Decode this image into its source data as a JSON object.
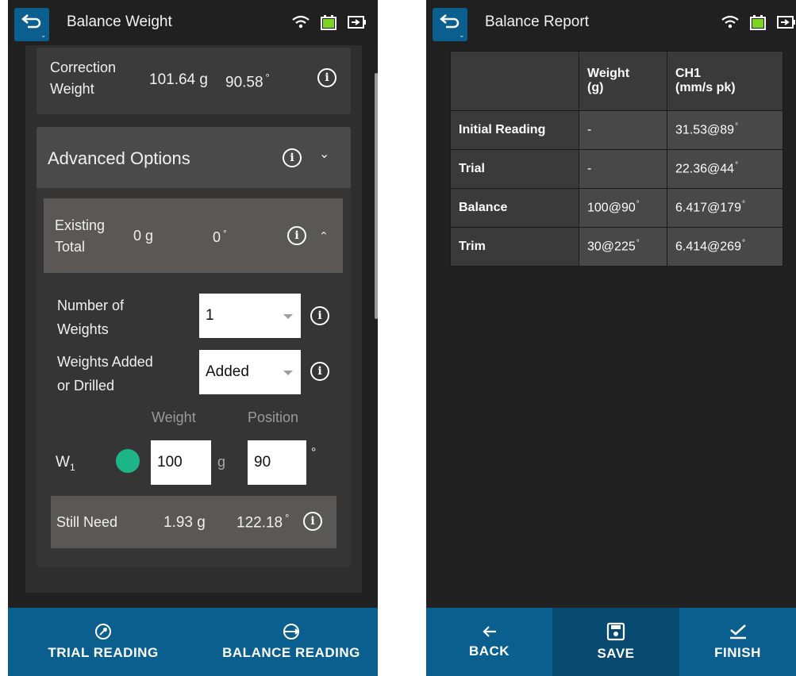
{
  "left": {
    "title": "Balance Weight",
    "correction": {
      "label_line1": "Correction",
      "label_line2": "Weight",
      "weight": "101.64 g",
      "angle": "90.58",
      "deg": "°"
    },
    "advanced": {
      "title": "Advanced Options"
    },
    "existing": {
      "label_line1": "Existing",
      "label_line2": "Total",
      "weight": "0 g",
      "angle": "0",
      "deg": "°"
    },
    "num_weights": {
      "label_line1": "Number of",
      "label_line2": "Weights",
      "value": "1"
    },
    "weights_added": {
      "label_line1": "Weights Added",
      "label_line2": "or Drilled",
      "value": "Added"
    },
    "columns": {
      "weight": "Weight",
      "position": "Position"
    },
    "w1": {
      "label": "W",
      "sub": "1",
      "weight_value": "100",
      "weight_unit": "g",
      "position_value": "90",
      "deg": "°"
    },
    "still_need": {
      "label": "Still Need",
      "weight": "1.93 g",
      "angle": "122.18",
      "deg": "°"
    },
    "buttons": {
      "trial": "TRIAL READING",
      "balance": "BALANCE READING"
    },
    "colors": {
      "accent": "#0a5f8f",
      "dot": "#1db587"
    }
  },
  "right": {
    "title": "Balance Report",
    "table": {
      "headers": [
        "",
        "Weight\n(g)",
        "CH1\n(mm/s pk)"
      ],
      "header_weight_line1": "Weight",
      "header_weight_line2": "(g)",
      "header_ch1_line1": "CH1",
      "header_ch1_line2": "(mm/s pk)",
      "rows": [
        {
          "name": "Initial Reading",
          "weight": "-",
          "ch1": "31.53@89"
        },
        {
          "name": "Trial",
          "weight": "-",
          "ch1": "22.36@44"
        },
        {
          "name": "Balance",
          "weight": "100@90",
          "ch1": "6.417@179"
        },
        {
          "name": "Trim",
          "weight": "30@225",
          "ch1": "6.414@269"
        }
      ],
      "deg": "°"
    },
    "buttons": {
      "back": "BACK",
      "save": "SAVE",
      "finish": "FINISH"
    }
  }
}
